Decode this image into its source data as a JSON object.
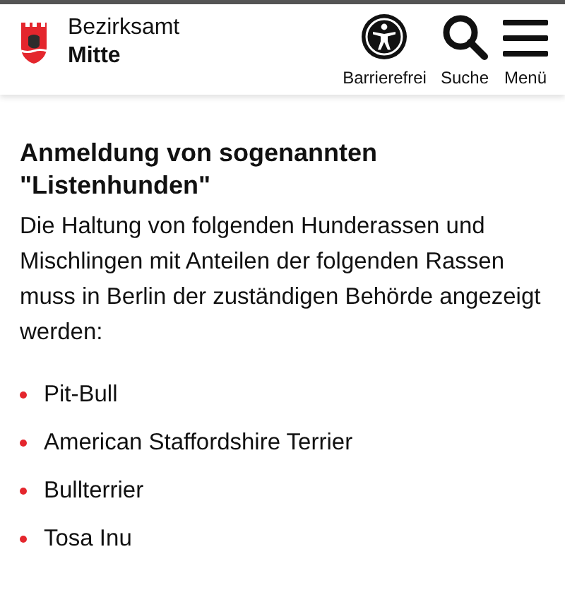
{
  "header": {
    "org_line1": "Bezirksamt",
    "org_line2": "Mitte",
    "actions": [
      {
        "kind": "accessibility",
        "label": "Barrierefrei"
      },
      {
        "kind": "search",
        "label": "Suche"
      },
      {
        "kind": "menu",
        "label": "Menü"
      }
    ]
  },
  "article": {
    "heading": "Anmeldung von sogenannten \"Listenhunden\"",
    "intro": "Die Haltung von folgenden Hunderassen und Mischlingen mit Anteilen der folgenden Rassen muss in Berlin der zuständigen Behörde angezeigt werden:",
    "items": [
      "Pit-Bull",
      "American Staffordshire Terrier",
      "Bullterrier",
      "Tosa Inu"
    ]
  }
}
